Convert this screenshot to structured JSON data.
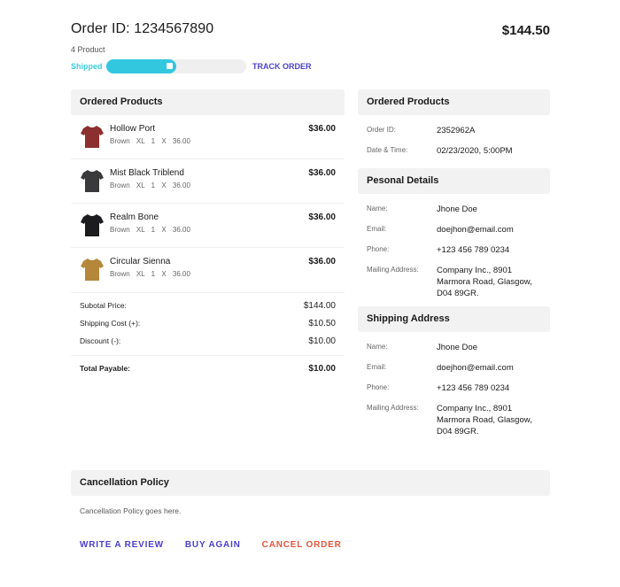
{
  "order": {
    "title": "Order ID: 1234567890",
    "product_count": "4 Product",
    "total": "$144.50",
    "status_label": "Shipped",
    "progress_fraction": 0.5,
    "track_label": "TRACK ORDER"
  },
  "ordered_products": {
    "heading": "Ordered Products",
    "items": [
      {
        "name": "Hollow Port",
        "color": "Brown",
        "size": "XL",
        "qty": "1 X 36.00",
        "price": "$36.00",
        "shirt_color": "#8c2f2f"
      },
      {
        "name": "Mist Black Triblend",
        "color": "Brown",
        "size": "XL",
        "qty": "1 X 36.00",
        "price": "$36.00",
        "shirt_color": "#3a3a3c"
      },
      {
        "name": "Realm Bone",
        "color": "Brown",
        "size": "XL",
        "qty": "1 X 36.00",
        "price": "$36.00",
        "shirt_color": "#1c1c1e"
      },
      {
        "name": "Circular Sienna",
        "color": "Brown",
        "size": "XL",
        "qty": "1 X 36.00",
        "price": "$36.00",
        "shirt_color": "#b4873a"
      }
    ],
    "summary": {
      "subtotal_label": "Subotal Price:",
      "subtotal": "$144.00",
      "shipping_label": "Shipping Cost (+):",
      "shipping": "$10.50",
      "discount_label": "Discount (-):",
      "discount": "$10.00",
      "payable_label": "Total Payable:",
      "payable": "$10.00"
    }
  },
  "order_info": {
    "heading": "Ordered Products",
    "order_id_label": "Order ID:",
    "order_id": "2352962A",
    "datetime_label": "Date & Time:",
    "datetime": "02/23/2020, 5:00PM"
  },
  "personal": {
    "heading": "Pesonal Details",
    "name_label": "Name:",
    "name": "Jhone Doe",
    "email_label": "Email:",
    "email": "doejhon@email.com",
    "phone_label": "Phone:",
    "phone": "+123 456 789 0234",
    "address_label": "Mailing Address:",
    "address": "Company Inc., 8901 Marmora Road, Glasgow, D04 89GR."
  },
  "shipping": {
    "heading": "Shipping Address",
    "name_label": "Name:",
    "name": "Jhone Doe",
    "email_label": "Email:",
    "email": "doejhon@email.com",
    "phone_label": "Phone:",
    "phone": "+123 456 789 0234",
    "address_label": "Mailing Address:",
    "address": "Company Inc., 8901 Marmora Road, Glasgow, D04 89GR."
  },
  "cancellation": {
    "heading": "Cancellation Policy",
    "text": "Cancellation Policy goes here."
  },
  "actions": {
    "review": "WRITE A REVIEW",
    "buy_again": "BUY AGAIN",
    "cancel": "CANCEL ORDER"
  },
  "colors": {
    "accent_progress": "#33c7df",
    "link": "#4c3fcf",
    "danger": "#e8553a"
  }
}
